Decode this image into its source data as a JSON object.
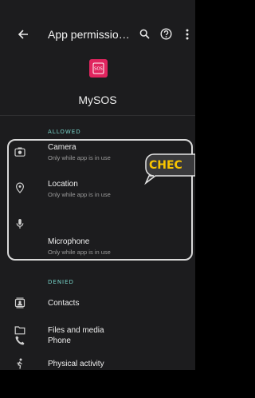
{
  "header": {
    "title": "App permissio…",
    "icons": [
      "back-arrow-icon",
      "search-icon",
      "help-icon",
      "more-vert-icon"
    ]
  },
  "app": {
    "name": "MySOS",
    "icon_color": "#e0245e",
    "icon_glyph": "SOS"
  },
  "sections": {
    "allowed_label": "ALLOWED",
    "denied_label": "DENIED"
  },
  "allowed": [
    {
      "title": "Camera",
      "subtitle": "Only while app is in use",
      "icon": "camera-icon"
    },
    {
      "title": "Location",
      "subtitle": "Only while app is in use",
      "icon": "location-pin-icon"
    },
    {
      "title": "Microphone",
      "subtitle": "Only while app is in use",
      "icon": "microphone-icon"
    }
  ],
  "denied": [
    {
      "title": "Contacts",
      "icon": "contacts-icon"
    },
    {
      "title": "Files and media",
      "icon": "folder-icon"
    },
    {
      "title": "Phone",
      "icon": "phone-icon"
    },
    {
      "title": "Physical activity",
      "icon": "activity-icon"
    }
  ],
  "annotation": {
    "text": "CHEC",
    "border_color": "#d9d9d9",
    "text_color": "#f8c400"
  },
  "colors": {
    "background": "#1c1c1e",
    "section_label": "#77d3c8"
  }
}
